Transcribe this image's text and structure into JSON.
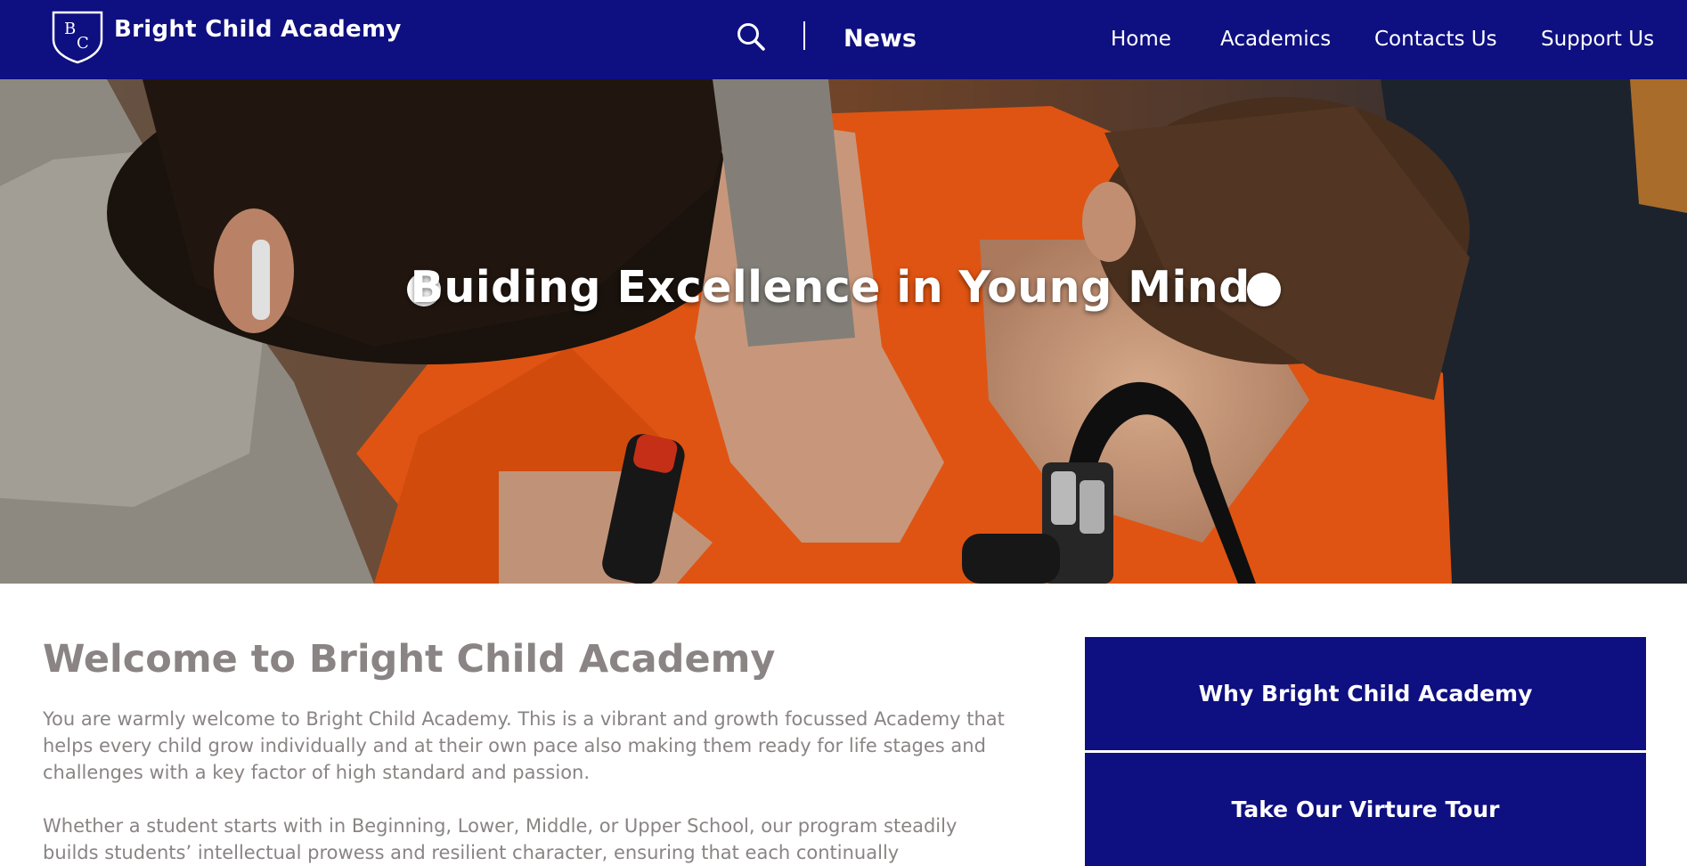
{
  "header": {
    "logo_letters": [
      "B",
      "C"
    ],
    "brand": "Bright Child Academy",
    "news": "News",
    "nav": [
      {
        "label": "Home"
      },
      {
        "label": "Academics"
      },
      {
        "label": "Contacts Us"
      },
      {
        "label": "Support Us"
      }
    ]
  },
  "hero": {
    "title": "Buiding Excellence in Young Minds"
  },
  "welcome": {
    "title": "Welcome to Bright Child Academy",
    "paragraph1": "You are warmly welcome to Bright Child Academy. This is a vibrant and growth focussed Academy that helps every child grow individually and at their own pace also making them ready for life stages and challenges with a key factor of high standard and passion.",
    "paragraph2": "Whether a student starts with in Beginning, Lower, Middle, or Upper School, our program steadily builds students’ intellectual prowess and resilient character, ensuring that each continually"
  },
  "cta": {
    "why": "Why Bright Child Academy",
    "tour": "Take Our Virture Tour"
  },
  "colors": {
    "primary": "#0e0f80",
    "text_gray": "#8a8484",
    "accent_orange": "#f25c14"
  },
  "icons": {
    "search": "search-icon",
    "logo": "shield-logo-icon"
  }
}
